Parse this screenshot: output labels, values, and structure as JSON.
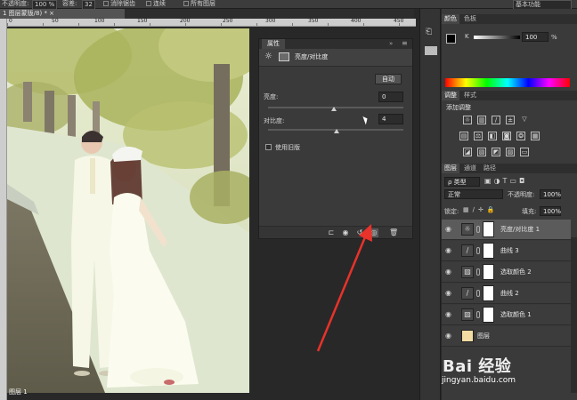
{
  "options_bar": {
    "transparency_label": "不透明度:",
    "transparency_value": "100 %",
    "flow_label": "容差:",
    "flow_value": "32",
    "anti_alias_label": "消除锯齿",
    "contiguous_label": "连续",
    "all_layers_label": "所有图层",
    "workspace_value": "基本功能"
  },
  "document": {
    "tab_label": "1 图层蒙版/8) * ×",
    "ruler_ticks": [
      "0",
      "50",
      "100",
      "150",
      "200",
      "250",
      "300",
      "350",
      "400",
      "450"
    ],
    "photo_label": "图层 1"
  },
  "properties": {
    "tab_label": "属性",
    "panel_title": "亮度/对比度",
    "auto_label": "自动",
    "brightness_label": "亮度:",
    "brightness_value": "0",
    "contrast_label": "对比度:",
    "contrast_value": "4",
    "legacy_label": "使用旧版",
    "brightness_position": 0.5,
    "contrast_position": 0.52
  },
  "color_panel": {
    "tabs": [
      "颜色",
      "色板"
    ],
    "channel_label": "K",
    "value": "100",
    "unit": "%"
  },
  "adjustments_panel": {
    "tabs": [
      "调整",
      "样式"
    ],
    "heading": "添加调整"
  },
  "layers_panel": {
    "tabs": [
      "图层",
      "通道",
      "路径"
    ],
    "filter_label": "类型",
    "blend_mode": "正常",
    "opacity_label": "不透明度:",
    "opacity_value": "100%",
    "lock_label": "锁定:",
    "fill_label": "填充:",
    "fill_value": "100%",
    "layers": [
      {
        "name": "亮度/对比度 1",
        "icon": "sun-icon",
        "selected": true
      },
      {
        "name": "曲线 3",
        "icon": "curves-icon",
        "selected": false
      },
      {
        "name": "选取颜色 2",
        "icon": "selective-color-icon",
        "selected": false
      },
      {
        "name": "曲线 2",
        "icon": "curves-icon",
        "selected": false
      },
      {
        "name": "选取颜色 1",
        "icon": "selective-color-icon",
        "selected": false
      },
      {
        "name": "图层",
        "icon": "image-layer-icon",
        "selected": false
      }
    ]
  },
  "watermark": {
    "brand": "Bai 经验",
    "url": "jingyan.baidu.com"
  },
  "colors": {
    "accent_arrow": "#e8322a",
    "selected_layer": "#5b5b5b",
    "panel_bg": "#3a3a3a"
  }
}
